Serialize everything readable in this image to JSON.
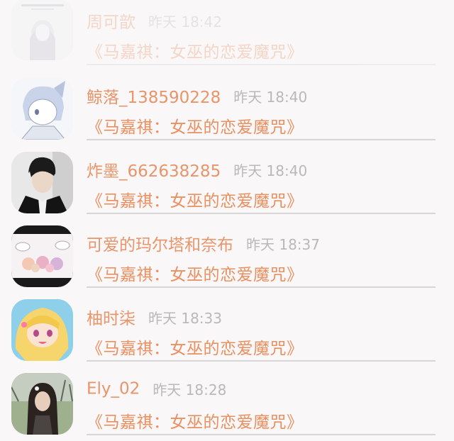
{
  "feed": {
    "items": [
      {
        "username": "周可歆",
        "time": "昨天 18:42",
        "title": "《马嘉祺：女巫的恋爱魔咒》",
        "avatar_icon": "sketch-girl-avatar"
      },
      {
        "username": "鲸落_138590228",
        "time": "昨天 18:40",
        "title": "《马嘉祺：女巫的恋爱魔咒》",
        "avatar_icon": "anime-fox-boy-avatar"
      },
      {
        "username": "炸墨_662638285",
        "time": "昨天 18:40",
        "title": "《马嘉祺：女巫的恋爱魔咒》",
        "avatar_icon": "portrait-photo-avatar"
      },
      {
        "username": "可爱的玛尔塔和奈布",
        "time": "昨天 18:37",
        "title": "《马嘉祺：女巫的恋爱魔咒》",
        "avatar_icon": "chibi-group-avatar"
      },
      {
        "username": "柚时柒",
        "time": "昨天 18:33",
        "title": "《马嘉祺：女巫的恋爱魔咒》",
        "avatar_icon": "anime-blonde-girl-avatar"
      },
      {
        "username": "Ely_02",
        "time": "昨天 18:28",
        "title": "《马嘉祺：女巫的恋爱魔咒》",
        "avatar_icon": "outdoor-photo-avatar"
      }
    ]
  },
  "colors": {
    "username": "#e8956a",
    "time": "#b9b9b9",
    "title": "#eb8f5f",
    "divider": "#d6d6d6",
    "background": "#f9f7f8"
  }
}
